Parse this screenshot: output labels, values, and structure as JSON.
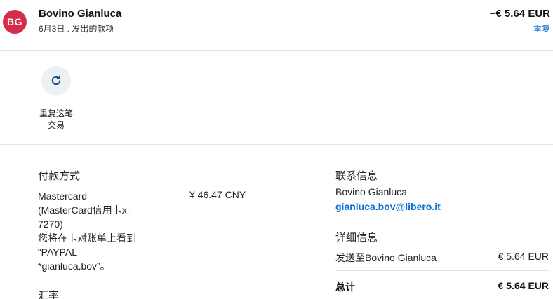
{
  "header": {
    "avatar_initials": "BG",
    "avatar_color": "#d62b4b",
    "name": "Bovino Gianluca",
    "subline": "6月3日 . 发出的款项",
    "amount": "−€ 5.64 EUR",
    "repeat_link": "重复"
  },
  "action": {
    "icon": "refresh-icon",
    "label_line1": "重复这笔",
    "label_line2": "交易"
  },
  "payment": {
    "title": "付款方式",
    "method_lines": [
      "Mastercard",
      "(MasterCard信用卡x-",
      "7270)",
      "您将在卡对账单上看到",
      "“PAYPAL",
      "*gianluca.bov”。"
    ],
    "amount": "¥ 46.47 CNY",
    "exchange_title": "汇率"
  },
  "contact": {
    "title": "联系信息",
    "name": "Bovino Gianluca",
    "email": "gianluca.bov@libero.it"
  },
  "details": {
    "title": "详细信息",
    "row_label": "发送至Bovino Gianluca",
    "row_value": "€ 5.64 EUR",
    "total_label": "总计",
    "total_value": "€ 5.64 EUR"
  },
  "colors": {
    "link": "#0a6fd1",
    "divider": "#e3e3e3",
    "action_bg": "#eef1f4"
  }
}
